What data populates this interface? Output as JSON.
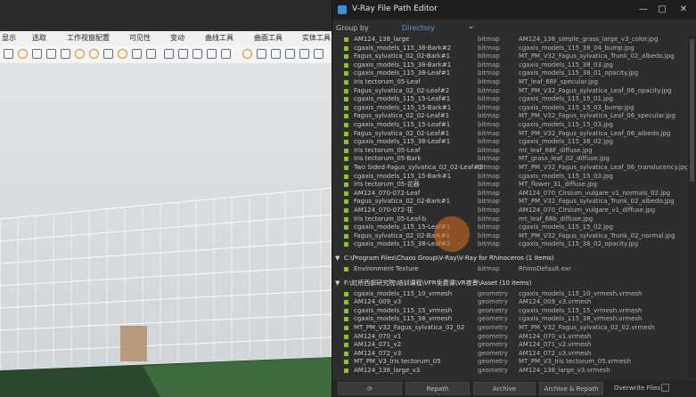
{
  "rhino": {
    "menu": [
      "显示",
      "选取",
      "工作视窗配置",
      "可见性",
      "变动",
      "曲线工具",
      "曲面工具",
      "实体工具"
    ]
  },
  "window": {
    "title": "V-Ray File Path Editor",
    "minimize_icon": "minimize-icon",
    "maximize_icon": "maximize-icon",
    "close_icon": "close-icon"
  },
  "group_by": {
    "label": "Group by",
    "value": "Directory"
  },
  "rows_top": [
    {
      "name": "AM124_138_large",
      "type": "bitmap",
      "file": "AM124_138_simple_grass_large_v3_color.jpg"
    },
    {
      "name": "cgaxis_models_115_38-Bark#2",
      "type": "bitmap",
      "file": "cgaxis_models_115_38_04_bump.jpg"
    },
    {
      "name": "Fagus_sylvatica_02_02-Bark#1",
      "type": "bitmap",
      "file": "MT_PM_V32_Fagus_sylvatica_Trunk_02_albedo.jpg"
    },
    {
      "name": "cgaxis_models_115_38-Bark#1",
      "type": "bitmap",
      "file": "cgaxis_models_115_38_03.jpg"
    },
    {
      "name": "cgaxis_models_115_38-Leaf#1",
      "type": "bitmap",
      "file": "cgaxis_models_115_38_01_opacity.jpg"
    },
    {
      "name": "Iris tectorum_05-Leaf",
      "type": "bitmap",
      "file": "MT_leaf_68F_specular.jpg"
    },
    {
      "name": "Fagus_sylvatica_02_02-Leaf#2",
      "type": "bitmap",
      "file": "MT_PM_V32_Fagus_sylvatica_Leaf_06_opacity.jpg"
    },
    {
      "name": "cgaxis_models_115_15-Leaf#1",
      "type": "bitmap",
      "file": "cgaxis_models_115_15_01.jpg"
    },
    {
      "name": "cgaxis_models_115_15-Bark#1",
      "type": "bitmap",
      "file": "cgaxis_models_115_15_03_bump.jpg"
    },
    {
      "name": "Fagus_sylvatica_02_02-Leaf#1",
      "type": "bitmap",
      "file": "MT_PM_V32_Fagus_sylvatica_Leaf_06_specular.jpg"
    },
    {
      "name": "cgaxis_models_115_15-Leaf#1",
      "type": "bitmap",
      "file": "cgaxis_models_115_15_03.jpg"
    },
    {
      "name": "Fagus_sylvatica_02_02-Leaf#1",
      "type": "bitmap",
      "file": "MT_PM_V32_Fagus_sylvatica_Leaf_06_albedo.jpg"
    },
    {
      "name": "cgaxis_models_115_38-Leaf#1",
      "type": "bitmap",
      "file": "cgaxis_models_115_38_02.jpg"
    },
    {
      "name": "Iris tectorum_05-Leaf",
      "type": "bitmap",
      "file": "mt_leaf_68F_diffuse.jpg"
    },
    {
      "name": "Iris tectorum_05-Bark",
      "type": "bitmap",
      "file": "MT_grass_leaf_02_diffuse.jpg"
    },
    {
      "name": "Two Sided-Fagus_sylvatica_02_02-Leaf#2",
      "type": "bitmap",
      "file": "MT_PM_V32_Fagus_sylvatica_Leaf_06_translucency.jpg"
    },
    {
      "name": "cgaxis_models_115_15-Bark#1",
      "type": "bitmap",
      "file": "cgaxis_models_115_15_03.jpg"
    },
    {
      "name": "Iris tectorum_05-花器",
      "type": "bitmap",
      "file": "MT_flower_31_diffuse.jpg"
    },
    {
      "name": "AM124_070-072-Leaf",
      "type": "bitmap",
      "file": "AM124_070_Cirsium_vulgare_v1_normals_02.jpg"
    },
    {
      "name": "Fagus_sylvatica_02_02-Bark#1",
      "type": "bitmap",
      "file": "MT_PM_V32_Fagus_sylvatica_Trunk_02_albedo.jpg"
    },
    {
      "name": "AM124_070-072-花",
      "type": "bitmap",
      "file": "AM124_070_Cirsium_vulgare_v1_diffuse.jpg"
    },
    {
      "name": "Iris tectorum_05-Leaf-b",
      "type": "bitmap",
      "file": "mt_leaf_68b_diffuse.jpg"
    },
    {
      "name": "cgaxis_models_115_15-Leaf#1",
      "type": "bitmap",
      "file": "cgaxis_models_115_15_02.jpg"
    },
    {
      "name": "Fagus_sylvatica_02_02-Bark#1",
      "type": "bitmap",
      "file": "MT_PM_V32_Fagus_sylvatica_Trunk_02_normal.jpg"
    },
    {
      "name": "cgaxis_models_115_38-Leaf#2",
      "type": "bitmap",
      "file": "cgaxis_models_115_38_02_opacity.jpg"
    }
  ],
  "section1": {
    "label": "C:\\Program Files\\Chaos Group\\V-Ray\\V-Ray for Rhinoceros (1 items)"
  },
  "rows_mid": [
    {
      "name": "Environment Texture",
      "type": "bitmap",
      "file": "RhinoDefault.exr"
    }
  ],
  "section2": {
    "label": "F:\\虹桥西部研究院\\培训课程\\VFR免费课\\VR夜景\\Asset (10 items)"
  },
  "rows_bottom": [
    {
      "name": "cgaxis_models_115_10_vrmesh",
      "type": "geometry",
      "file": "cgaxis_models_115_10_vrmesh.vrmesh"
    },
    {
      "name": "AM124_009_v3",
      "type": "geometry",
      "file": "AM124_009_v3.vrmesh"
    },
    {
      "name": "cgaxis_models_115_15_vrmesh",
      "type": "geometry",
      "file": "cgaxis_models_115_15_vrmesh.vrmesh"
    },
    {
      "name": "cgaxis_models_115_38_vrmesh",
      "type": "geometry",
      "file": "cgaxis_models_115_38_vrmesh.vrmesh"
    },
    {
      "name": "MT_PM_V32_Fagus_sylvatica_02_02",
      "type": "geometry",
      "file": "MT_PM_V32_Fagus_sylvatica_02_02.vrmesh"
    },
    {
      "name": "AM124_070_v1",
      "type": "geometry",
      "file": "AM124_070_v1.vrmesh"
    },
    {
      "name": "AM124_071_v2",
      "type": "geometry",
      "file": "AM124_071_v2.vrmesh"
    },
    {
      "name": "AM124_072_v3",
      "type": "geometry",
      "file": "AM124_072_v3.vrmesh"
    },
    {
      "name": "MT_PM_V3_Iris tectorum_05",
      "type": "geometry",
      "file": "MT_PM_V3_Iris tectorum_05.vrmesh"
    },
    {
      "name": "AM124_138_large_v3",
      "type": "geometry",
      "file": "AM124_138_large_v3.vrmesh"
    }
  ],
  "bottom": {
    "refresh_icon": "refresh-icon",
    "repath": "Repath",
    "archive": "Archive",
    "archive_repath": "Archive & Repath",
    "overwrite": "Overwrite Files"
  },
  "colors": {
    "accent": "#4b9be0",
    "file_square": "#8fc31f",
    "bg": "#2d2d2d"
  }
}
